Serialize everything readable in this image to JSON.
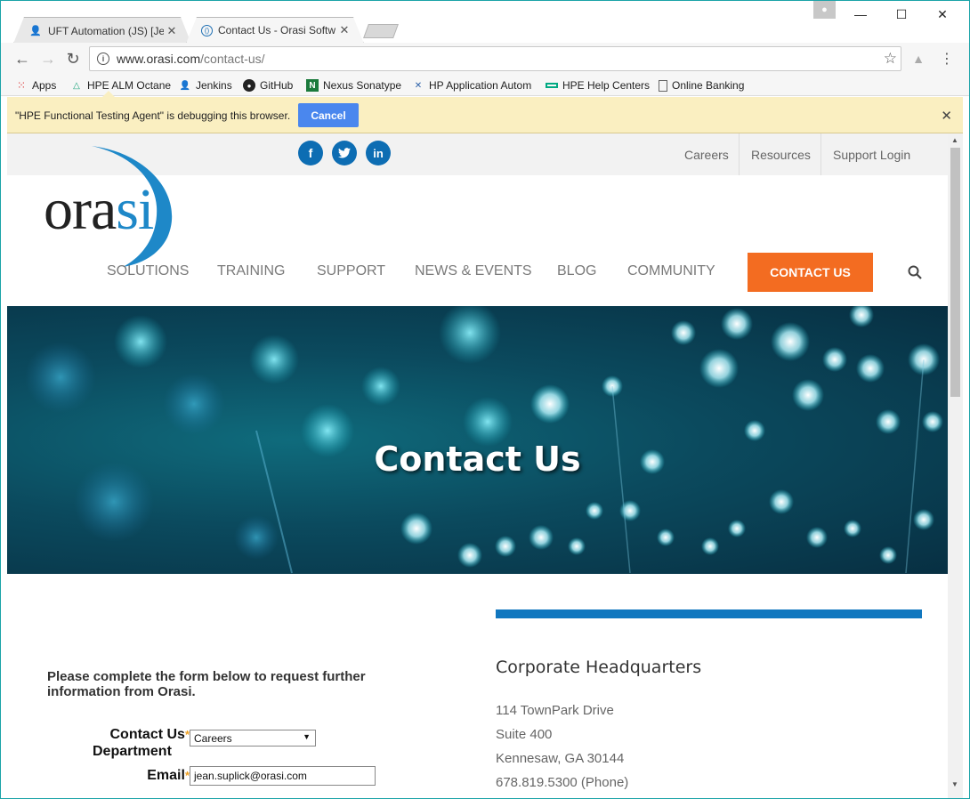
{
  "browser": {
    "tabs": [
      {
        "title": "UFT Automation (JS) [Jen",
        "active": false
      },
      {
        "title": "Contact Us - Orasi Softw",
        "active": true
      }
    ],
    "url": {
      "host": "www.orasi.com",
      "path": "/contact-us/"
    },
    "bookmarks": [
      "Apps",
      "HPE ALM Octane",
      "Jenkins",
      "GitHub",
      "Nexus Sonatype",
      "HP Application Autom",
      "HPE Help Centers",
      "Online Banking"
    ],
    "infobar": {
      "message": "\"HPE Functional Testing Agent\" is debugging this browser.",
      "button": "Cancel"
    }
  },
  "site": {
    "social": [
      "f",
      "t",
      "in"
    ],
    "toplinks": [
      "Careers",
      "Resources",
      "Support Login"
    ],
    "logo": {
      "part1": "ora",
      "part2": "si"
    },
    "nav": [
      "SOLUTIONS",
      "TRAINING",
      "SUPPORT",
      "NEWS & EVENTS",
      "BLOG",
      "COMMUNITY"
    ],
    "contact_button": "CONTACT US",
    "hero_title": "Contact Us"
  },
  "form": {
    "intro": "Please complete the form below to request further information from Orasi.",
    "dept_label": "Contact Us",
    "dept_label2": "Department",
    "dept_value": "Careers",
    "email_label": "Email",
    "email_value": "jean.suplick@orasi.com",
    "required_mark": "*"
  },
  "hq": {
    "title": "Corporate Headquarters",
    "lines": [
      "114 TownPark Drive",
      "Suite 400",
      "Kennesaw, GA 30144",
      "678.819.5300 (Phone)"
    ]
  },
  "colors": {
    "accent": "#f36c21",
    "brand_blue": "#1177bf",
    "infobar": "#faefc1"
  }
}
